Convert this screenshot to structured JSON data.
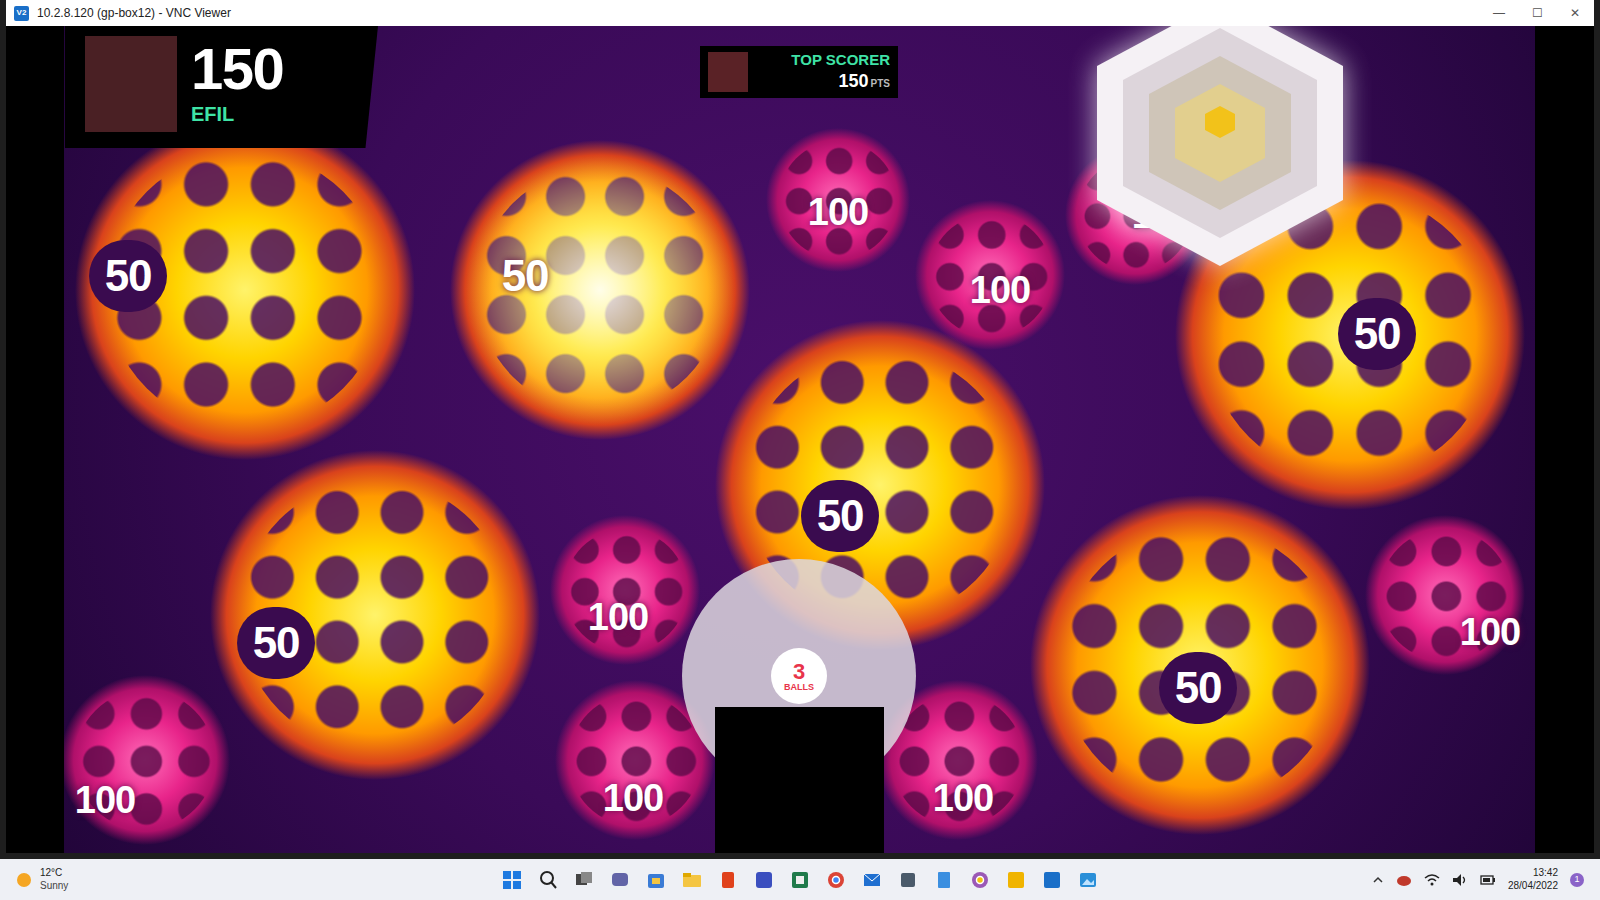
{
  "window": {
    "title": "10.2.8.120 (gp-box12) - VNC Viewer",
    "icon": "V2",
    "controls": [
      "—",
      "☐",
      "✕"
    ]
  },
  "game": {
    "player": {
      "score": "150",
      "name": "EFIL"
    },
    "top_scorer": {
      "label": "TOP SCORER",
      "score": "150",
      "unit": "PTS"
    },
    "balls_left": {
      "count": "3",
      "label": "BALLS"
    },
    "targets": [
      {
        "points": "50",
        "kind": "large",
        "lit": false
      },
      {
        "points": "50",
        "kind": "large",
        "lit": true
      },
      {
        "points": "100",
        "kind": "small",
        "lit": false
      },
      {
        "points": "100",
        "kind": "small",
        "lit": false
      },
      {
        "points": "100",
        "kind": "small",
        "lit": false
      },
      {
        "points": "50",
        "kind": "large",
        "lit": false
      },
      {
        "points": "50",
        "kind": "large",
        "lit": false
      },
      {
        "points": "50",
        "kind": "large",
        "lit": false
      },
      {
        "points": "100",
        "kind": "small",
        "lit": false
      },
      {
        "points": "50",
        "kind": "large",
        "lit": false
      },
      {
        "points": "100",
        "kind": "small",
        "lit": false
      },
      {
        "points": "100",
        "kind": "small",
        "lit": false
      },
      {
        "points": "100",
        "kind": "small",
        "lit": false
      },
      {
        "points": "100",
        "kind": "small",
        "lit": false
      }
    ]
  },
  "taskbar": {
    "weather": {
      "temperature": "12°C",
      "condition": "Sunny"
    },
    "clock": {
      "time": "13:42",
      "date": "28/04/2022"
    },
    "notifications": "1"
  }
}
